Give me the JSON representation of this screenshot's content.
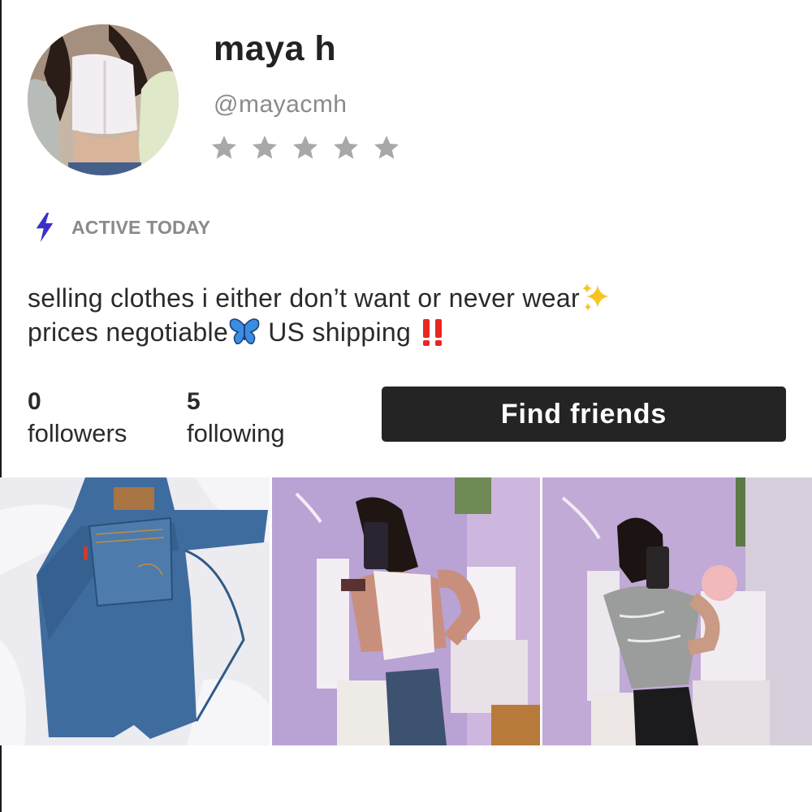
{
  "profile": {
    "display_name": "maya h",
    "username": "@mayacmh",
    "rating": 0,
    "rating_max": 5,
    "activity_status": "ACTIVE TODAY",
    "bio_line_1": "selling clothes i either don’t want or never wear",
    "bio_line_1_emoji": "sparkles",
    "bio_line_2_a": "prices negotiable",
    "bio_line_2_emoji_1": "butterfly",
    "bio_line_2_b": " US shipping ",
    "bio_line_2_emoji_2": "double-exclamation"
  },
  "stats": {
    "followers_count": "0",
    "followers_label": "followers",
    "following_count": "5",
    "following_label": "following"
  },
  "actions": {
    "find_friends_label": "Find friends"
  },
  "listings": [
    {
      "subject": "jeans-photo"
    },
    {
      "subject": "white-top-mirror-selfie"
    },
    {
      "subject": "grey-tee-mirror-selfie"
    }
  ],
  "colors": {
    "accent": "#3b2fc9",
    "star": "#a8a8a8",
    "muted_text": "#8a8a8a",
    "button": "#242424"
  }
}
